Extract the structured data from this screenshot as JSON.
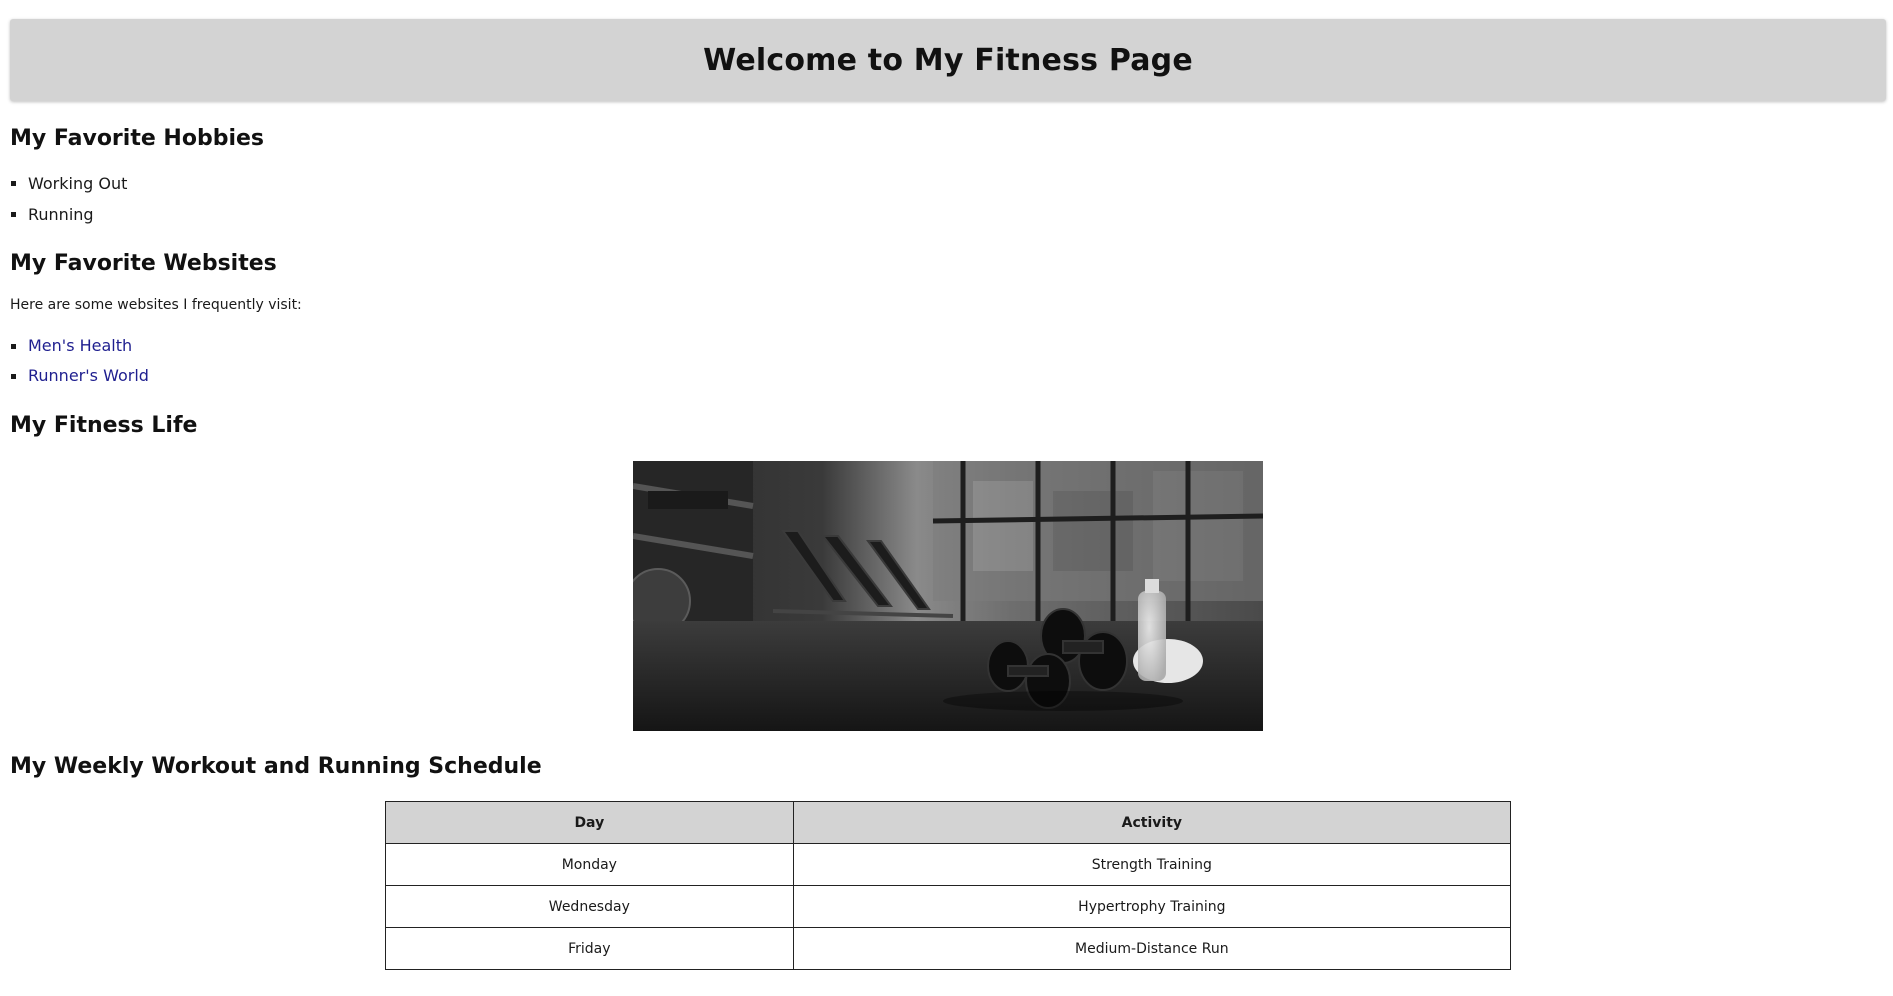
{
  "header": {
    "title": "Welcome to My Fitness Page"
  },
  "hobbies": {
    "heading": "My Favorite Hobbies",
    "items": [
      "Working Out",
      "Running"
    ]
  },
  "websites": {
    "heading": "My Favorite Websites",
    "intro": "Here are some websites I frequently visit:",
    "links": [
      "Men's Health",
      "Runner's World"
    ]
  },
  "fitness_life": {
    "heading": "My Fitness Life"
  },
  "schedule": {
    "heading": "My Weekly Workout and Running Schedule",
    "columns": [
      "Day",
      "Activity"
    ],
    "rows": [
      [
        "Monday",
        "Strength Training"
      ],
      [
        "Wednesday",
        "Hypertrophy Training"
      ],
      [
        "Friday",
        "Medium-Distance Run"
      ]
    ]
  },
  "colors": {
    "header_bg": "#d3d3d3",
    "link": "#1f1f8f",
    "table_header_bg": "#d3d3d3"
  }
}
